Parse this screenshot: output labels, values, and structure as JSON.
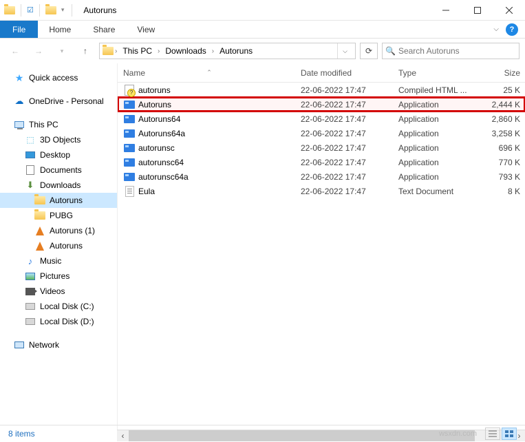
{
  "window": {
    "title": "Autoruns"
  },
  "ribbon": {
    "file": "File",
    "tabs": [
      "Home",
      "Share",
      "View"
    ]
  },
  "breadcrumbs": [
    "This PC",
    "Downloads",
    "Autoruns"
  ],
  "search": {
    "placeholder": "Search Autoruns"
  },
  "columns": {
    "name": "Name",
    "date": "Date modified",
    "type": "Type",
    "size": "Size"
  },
  "nav": {
    "quick_access": "Quick access",
    "onedrive": "OneDrive - Personal",
    "this_pc": "This PC",
    "objects3d": "3D Objects",
    "desktop": "Desktop",
    "documents": "Documents",
    "downloads": "Downloads",
    "autoruns": "Autoruns",
    "pubg": "PUBG",
    "autoruns1": "Autoruns (1)",
    "autoruns_vlc": "Autoruns",
    "music": "Music",
    "pictures": "Pictures",
    "videos": "Videos",
    "disk_c": "Local Disk (C:)",
    "disk_d": "Local Disk (D:)",
    "network": "Network"
  },
  "files": [
    {
      "name": "autoruns",
      "date": "22-06-2022 17:47",
      "type": "Compiled HTML ...",
      "size": "25 K",
      "icon": "chm"
    },
    {
      "name": "Autoruns",
      "date": "22-06-2022 17:47",
      "type": "Application",
      "size": "2,444 K",
      "icon": "exe",
      "highlight": true
    },
    {
      "name": "Autoruns64",
      "date": "22-06-2022 17:47",
      "type": "Application",
      "size": "2,860 K",
      "icon": "exe"
    },
    {
      "name": "Autoruns64a",
      "date": "22-06-2022 17:47",
      "type": "Application",
      "size": "3,258 K",
      "icon": "exe"
    },
    {
      "name": "autorunsc",
      "date": "22-06-2022 17:47",
      "type": "Application",
      "size": "696 K",
      "icon": "exe"
    },
    {
      "name": "autorunsc64",
      "date": "22-06-2022 17:47",
      "type": "Application",
      "size": "770 K",
      "icon": "exe"
    },
    {
      "name": "autorunsc64a",
      "date": "22-06-2022 17:47",
      "type": "Application",
      "size": "793 K",
      "icon": "exe"
    },
    {
      "name": "Eula",
      "date": "22-06-2022 17:47",
      "type": "Text Document",
      "size": "8 K",
      "icon": "txt"
    }
  ],
  "status": {
    "items": "8 items"
  },
  "watermark": "wsxdn.com"
}
